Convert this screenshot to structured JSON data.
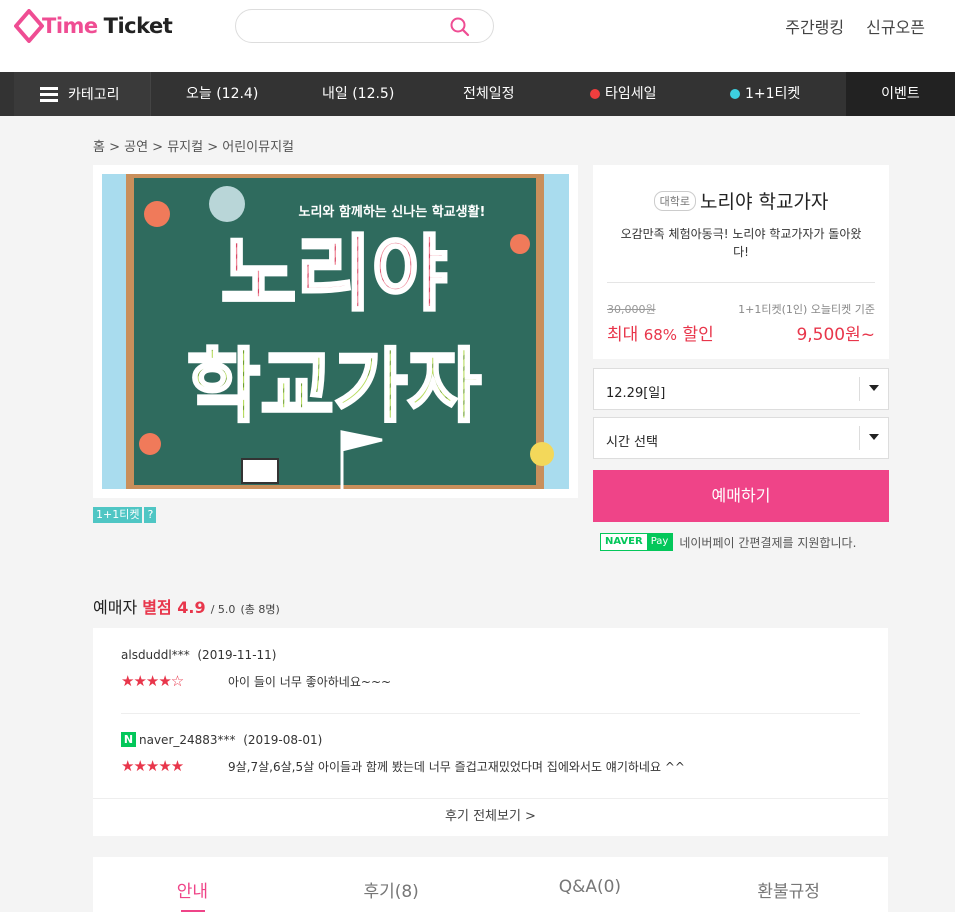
{
  "header": {
    "logo_text_pink": "Time",
    "logo_text_dark": "Ticket",
    "search_placeholder": "",
    "links": [
      "주간랭킹",
      "신규오픈"
    ]
  },
  "nav": {
    "category": "카테고리",
    "items": [
      "오늘 (12.4)",
      "내일 (12.5)",
      "전체일정",
      "타임세일",
      "1+1티켓"
    ],
    "event": "이벤트",
    "timesale_dot_color": "#f03e3e",
    "oneplus_dot_color": "#3dd0e0"
  },
  "breadcrumb": "홈 > 공연 > 뮤지컬 > 어린이뮤지컬",
  "poster": {
    "caption": "노리와 함께하는 신나는 학교생활!",
    "line1": "노리야",
    "line2": "학교가자"
  },
  "tags": [
    "1+1티켓",
    "?"
  ],
  "product": {
    "badge": "대학로",
    "title": "노리야 학교가자",
    "subtitle": "오감만족 체험아동극! 노리야 학교가자가 돌아왔다!",
    "original_price": "30,000원",
    "price_note": "1+1티켓(1인) 오늘티켓 기준",
    "discount_label": "최대",
    "discount_pct": "68%",
    "discount_suffix": "할인",
    "sale_price": "9,500원~"
  },
  "selects": {
    "date": "12.29[일]",
    "time": "시간 선택"
  },
  "book_button": "예매하기",
  "naverpay": {
    "logo_n": "NAVER",
    "logo_p": "Pay",
    "text": "네이버페이 간편결제를 지원합니다."
  },
  "rating": {
    "label": "예매자",
    "score_label": "별점 4.9",
    "max": "/ 5.0",
    "count": "(총 8명)"
  },
  "reviews": [
    {
      "user": "alsduddl***",
      "date": "(2019-11-11)",
      "stars": "★★★★☆",
      "text": "아이 들이 너무 좋아하네요~~~"
    },
    {
      "user": "naver_24883***",
      "date": "(2019-08-01)",
      "stars": "★★★★★",
      "text": "9살,7살,6살,5살 아이들과 함께 봤는데 너무 즐겁고재밌었다며 집에와서도 얘기하네요 ^^"
    }
  ],
  "review_more": "후기 전체보기 >",
  "tabs": [
    "안내",
    "후기(8)",
    "Q&A(0)",
    "환불규정"
  ]
}
